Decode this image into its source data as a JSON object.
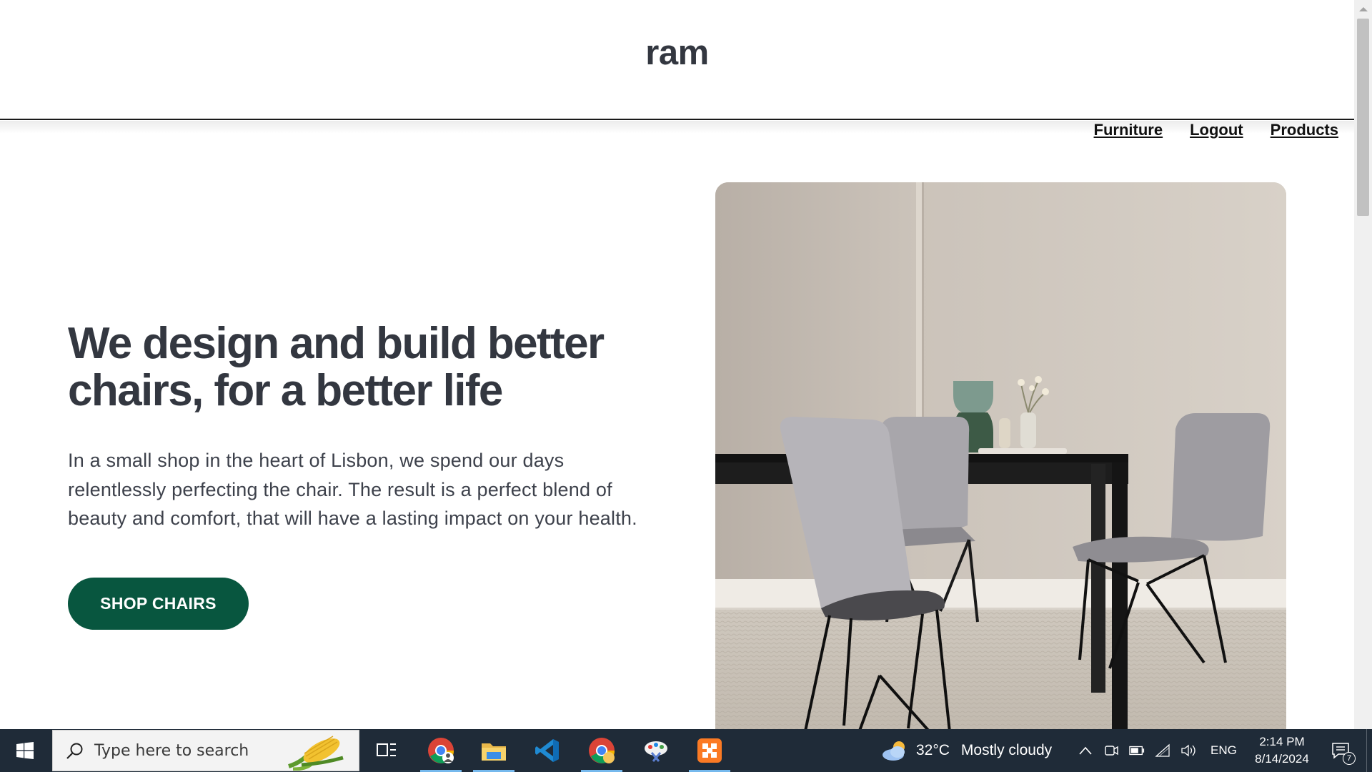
{
  "site": {
    "brand": "ram",
    "nav": [
      "Furniture",
      "Logout",
      "Products"
    ]
  },
  "hero": {
    "heading": "We design and build better chairs, for a better life",
    "text": "In a small shop in the heart of Lisbon, we spend our days relentlessly perfecting the chair. The result is a perfect blend of beauty and comfort, that will have a lasting impact on your health.",
    "cta": "SHOP CHAIRS",
    "image": "dining-table-with-chairs-photo"
  },
  "colors": {
    "cta_bg": "#08563f",
    "text": "#333740",
    "taskbar": "#1f2b38"
  },
  "taskbar": {
    "search_placeholder": "Type here to search",
    "apps": [
      "task-view-icon",
      "chrome-icon",
      "file-explorer-icon",
      "vscode-icon",
      "chrome-canary-icon",
      "paint-icon",
      "xampp-icon"
    ],
    "weather": {
      "temp": "32°C",
      "condition": "Mostly cloudy"
    },
    "language": "ENG",
    "time": "2:14 PM",
    "date": "8/14/2024",
    "notification_count": "7"
  }
}
